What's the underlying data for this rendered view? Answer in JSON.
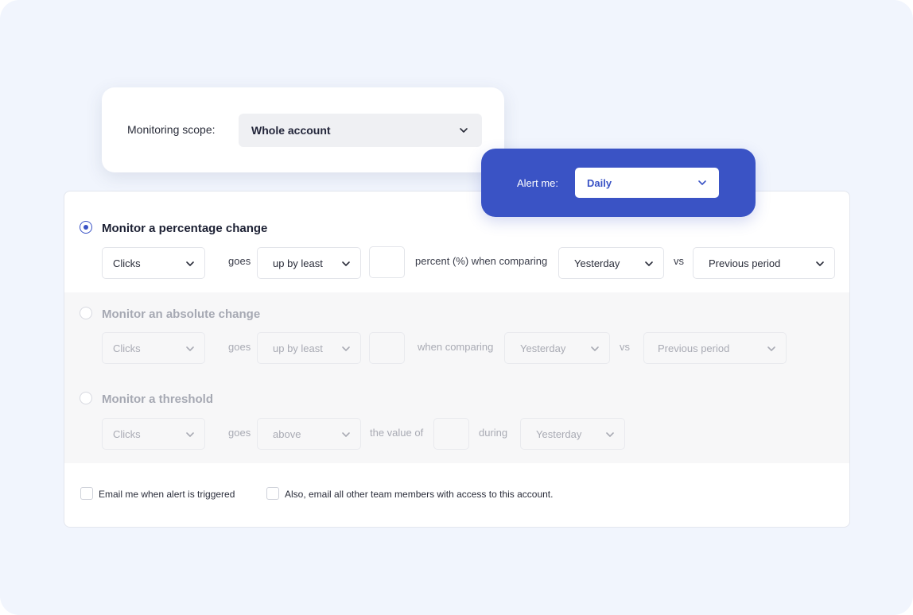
{
  "scope": {
    "label": "Monitoring scope:",
    "value": "Whole account"
  },
  "alert": {
    "label": "Alert me:",
    "value": "Daily",
    "accent_color": "#3a53c5"
  },
  "percentage": {
    "title": "Monitor a percentage change",
    "selected": true,
    "metric": "Clicks",
    "goes": "goes",
    "direction": "up by least",
    "value": "",
    "mid_text": "percent (%) when comparing",
    "period": "Yesterday",
    "vs": "vs",
    "compare": "Previous period"
  },
  "absolute": {
    "title": "Monitor an absolute change",
    "selected": false,
    "metric": "Clicks",
    "goes": "goes",
    "direction": "up by least",
    "value": "",
    "mid_text": "when comparing",
    "period": "Yesterday",
    "vs": "vs",
    "compare": "Previous period"
  },
  "threshold": {
    "title": "Monitor a threshold",
    "selected": false,
    "metric": "Clicks",
    "goes": "goes",
    "direction": "above",
    "value_text": "the value of",
    "value": "",
    "during": "during",
    "period": "Yesterday"
  },
  "email": {
    "self_label": "Email me when alert is triggered",
    "team_label": "Also, email all other team members with access to this account."
  },
  "icons": {
    "chevron": "chevron-down-icon"
  }
}
